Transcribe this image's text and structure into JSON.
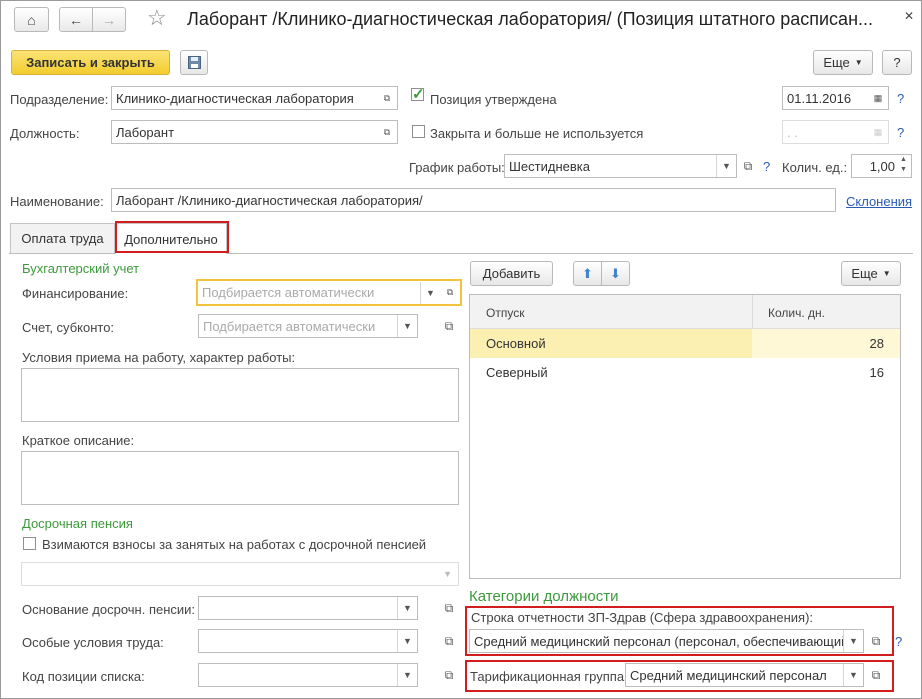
{
  "window": {
    "title": "Лаборант /Клинико-диагностическая лаборатория/ (Позиция штатного расписан..."
  },
  "toolbar": {
    "save_close": "Записать и закрыть",
    "more": "Еще",
    "help": "?"
  },
  "fields": {
    "subdivision_label": "Подразделение:",
    "subdivision_value": "Клинико-диагностическая лаборатория",
    "position_label": "Должность:",
    "position_value": "Лаборант",
    "approved_label": "Позиция утверждена",
    "approved_checked": true,
    "approved_date": "01.11.2016",
    "closed_label": "Закрыта и больше не используется",
    "closed_checked": false,
    "closed_date": " .  .",
    "schedule_label": "График работы:",
    "schedule_value": "Шестидневка",
    "units_label": "Колич. ед.:",
    "units_value": "1,00",
    "name_label": "Наименование:",
    "name_value": "Лаборант /Клинико-диагностическая лаборатория/",
    "declensions_link": "Склонения"
  },
  "tabs": [
    {
      "label": "Оплата труда",
      "active": false
    },
    {
      "label": "Дополнительно",
      "active": true
    }
  ],
  "accounting": {
    "section_title": "Бухгалтерский учет",
    "financing_label": "Финансирование:",
    "financing_placeholder": "Подбирается автоматически",
    "account_label": "Счет, субконто:",
    "account_placeholder": "Подбирается автоматически",
    "conditions_label": "Условия приема на работу, характер работы:",
    "conditions_value": "",
    "short_desc_label": "Краткое описание:",
    "short_desc_value": ""
  },
  "pension": {
    "section_title": "Досрочная пенсия",
    "contributions_label": "Взимаются взносы за занятых на работах с досрочной пенсией",
    "contributions_checked": false,
    "basis_label": "Основание досрочн. пенсии:",
    "special_label": "Особые условия труда:",
    "code_label": "Код позиции списка:"
  },
  "vacation": {
    "add_button": "Добавить",
    "more_button": "Еще",
    "columns": [
      "Отпуск",
      "Колич. дн."
    ],
    "rows": [
      {
        "name": "Основной",
        "days": "28",
        "selected": true
      },
      {
        "name": "Северный",
        "days": "16",
        "selected": false
      }
    ]
  },
  "categories": {
    "section_title": "Категории должности",
    "report_line_label": "Строка отчетности ЗП-Здрав (Сфера здравоохранения):",
    "report_line_value": "Средний медицинский персонал (персонал, обеспечивающий",
    "tariff_label": "Тарификационная группа:",
    "tariff_value": "Средний медицинский персонал"
  },
  "colors": {
    "accent_yellow": "#f6d94a",
    "highlight_red": "#d11d1d",
    "section_green": "#3c9a3c",
    "link_blue": "#2a5bb5",
    "selected_row": "#fbf0b2"
  }
}
